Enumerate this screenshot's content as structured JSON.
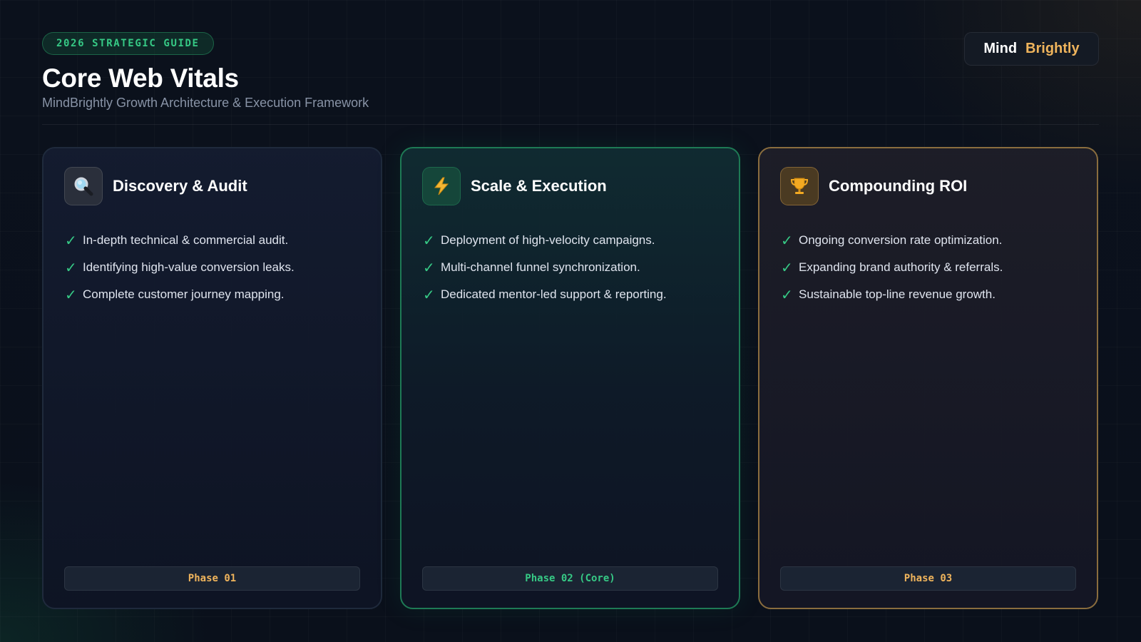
{
  "header": {
    "tag": "2026 STRATEGIC GUIDE",
    "title": "Core Web Vitals",
    "subtitle": "MindBrightly Growth Architecture & Execution Framework"
  },
  "brand": {
    "part1": "Mind",
    "part2": "Brightly"
  },
  "colors": {
    "accent_green": "#36c985",
    "accent_gold": "#efb45c",
    "background": "#0b111c",
    "card_border_default": "#1f2a3c",
    "card_border_green": "#1e7a55",
    "card_border_gold": "#8a6d3e"
  },
  "cards": [
    {
      "icon": "magnifier-icon",
      "title": "Discovery & Audit",
      "items": [
        "In-depth technical & commercial audit.",
        "Identifying high-value conversion leaks.",
        "Complete customer journey mapping."
      ],
      "phase": "Phase 01"
    },
    {
      "icon": "lightning-icon",
      "title": "Scale & Execution",
      "items": [
        "Deployment of high-velocity campaigns.",
        "Multi-channel funnel synchronization.",
        "Dedicated mentor-led support & reporting."
      ],
      "phase": "Phase 02 (Core)"
    },
    {
      "icon": "trophy-icon",
      "title": "Compounding ROI",
      "items": [
        "Ongoing conversion rate optimization.",
        "Expanding brand authority & referrals.",
        "Sustainable top-line revenue growth."
      ],
      "phase": "Phase 03"
    }
  ]
}
